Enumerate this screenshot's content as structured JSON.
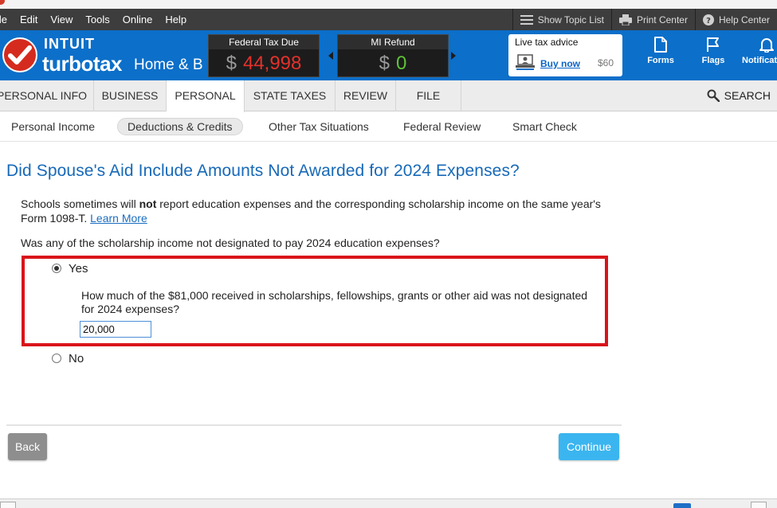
{
  "menu": {
    "items": [
      "ile",
      "Edit",
      "View",
      "Tools",
      "Online",
      "Help"
    ],
    "right": {
      "topic_list": "Show Topic List",
      "print_center": "Print Center",
      "help_center": "Help Center"
    }
  },
  "brand": {
    "intuit": "INTUIT",
    "turbotax": "turbotax",
    "edition": "Home & B"
  },
  "tax": {
    "federal_label": "Federal Tax Due",
    "federal_currency": "$",
    "federal_amount": "44,998",
    "state_label": "MI Refund",
    "state_currency": "$",
    "state_amount": "0"
  },
  "advice": {
    "title": "Live tax advice",
    "buy": "Buy now",
    "price": "$60"
  },
  "header_buttons": {
    "forms": "Forms",
    "flags": "Flags",
    "notifications": "Notificati"
  },
  "nav": {
    "tabs": [
      "PERSONAL INFO",
      "BUSINESS",
      "PERSONAL",
      "STATE TAXES",
      "REVIEW",
      "FILE"
    ],
    "active": "PERSONAL",
    "search": "SEARCH"
  },
  "subnav": {
    "items": [
      "Personal Income",
      "Deductions & Credits",
      "Other Tax Situations",
      "Federal Review",
      "Smart Check"
    ],
    "active": "Deductions & Credits"
  },
  "page": {
    "title": "Did Spouse's Aid Include Amounts Not Awarded for 2024 Expenses?",
    "intro_pre": "Schools sometimes will ",
    "intro_bold": "not",
    "intro_post": " report education expenses and the corresponding scholarship income on the same year's Form 1098-T. ",
    "learn_more": "Learn More",
    "question": "Was any of the scholarship income not designated to pay 2024 education expenses?",
    "option_yes": "Yes",
    "option_no": "No",
    "selected": "Yes",
    "followup": "How much of the $81,000 received in scholarships, fellowships, grants or other aid was not designated for 2024 expenses?",
    "amount_value": "20,000"
  },
  "buttons": {
    "back": "Back",
    "continue": "Continue"
  },
  "colors": {
    "header_blue": "#0c6fc9",
    "tax_due_red": "#e4312b",
    "refund_green": "#5ec337",
    "title_blue": "#1769b8",
    "highlight_red": "#d9141b",
    "continue_blue": "#3bb5ef"
  }
}
